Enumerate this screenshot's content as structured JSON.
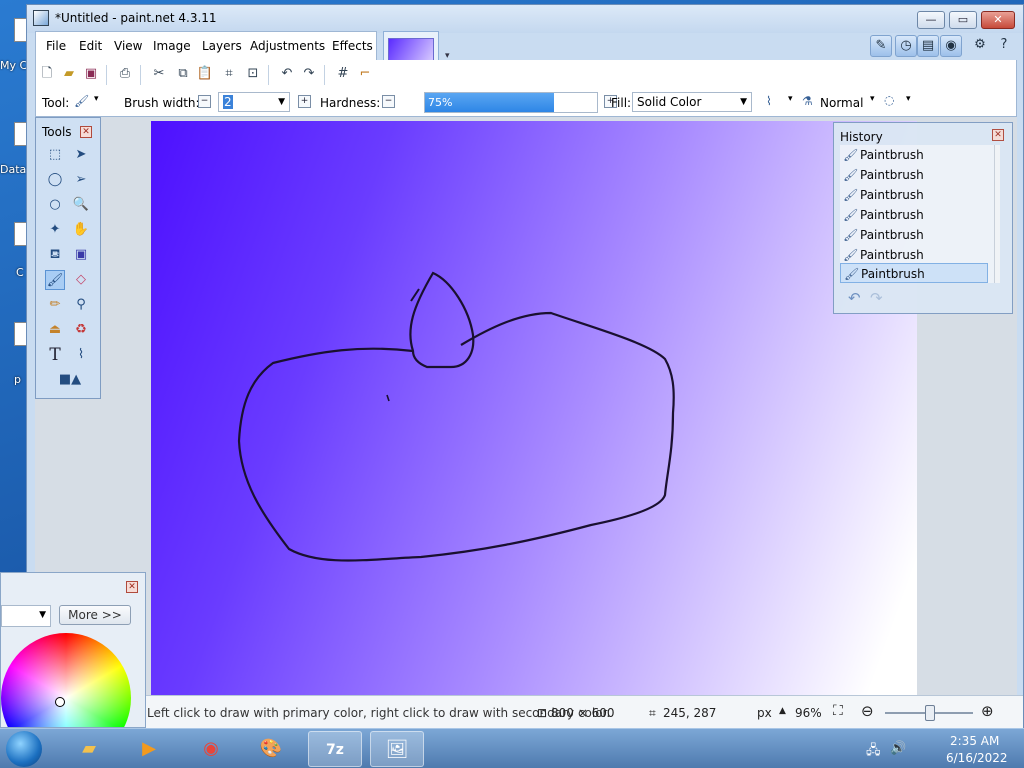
{
  "desktop": {
    "icons": [
      {
        "label": "My C"
      },
      {
        "label": "Data"
      },
      {
        "label": "C"
      },
      {
        "label": "p"
      }
    ]
  },
  "window": {
    "title": "*Untitled - paint.net 4.3.11",
    "controls": {
      "minimize": "—",
      "maximize": "▭",
      "close": "✕"
    }
  },
  "menu": {
    "items": [
      "File",
      "Edit",
      "View",
      "Image",
      "Layers",
      "Adjustments",
      "Effects"
    ]
  },
  "toolbar": {
    "tool_label": "Tool:",
    "brush_width_label": "Brush width:",
    "brush_width_value": "2",
    "hardness_label": "Hardness:",
    "hardness_value": "75%",
    "hardness_fraction": 0.75,
    "fill_label": "Fill:",
    "fill_value": "Solid Color",
    "blend_mode_value": "Normal"
  },
  "tools_panel": {
    "title": "Tools",
    "icons": [
      "rectangle-select-icon",
      "move-selection-icon",
      "lasso-select-icon",
      "move-selected-icon",
      "ellipse-select-icon",
      "zoom-icon",
      "magic-wand-icon",
      "pan-icon",
      "paint-bucket-icon",
      "gradient-icon",
      "paintbrush-icon",
      "eraser-icon",
      "pencil-icon",
      "color-picker-icon",
      "clone-stamp-icon",
      "recolor-icon",
      "text-icon",
      "line-curve-icon",
      "shapes-icon"
    ]
  },
  "history_panel": {
    "title": "History",
    "items": [
      "Paintbrush",
      "Paintbrush",
      "Paintbrush",
      "Paintbrush",
      "Paintbrush",
      "Paintbrush",
      "Paintbrush"
    ]
  },
  "colors_panel": {
    "more_label": "More >>"
  },
  "status": {
    "hint": "Left click to draw with primary color, right click to draw with secondary color.",
    "image_size": "800 × 600",
    "cursor_pos": "245, 287",
    "units": "px",
    "zoom": "96%"
  },
  "taskbar": {
    "time": "2:35 AM",
    "date": "6/16/2022",
    "items": [
      "explorer",
      "media-player",
      "chrome",
      "paint.net",
      "7z",
      "paint.net-active"
    ]
  },
  "colors": {
    "canvas_start": "#4d10ff",
    "canvas_end": "#ffffff",
    "stroke": "#1a1030",
    "accent": "#2e86e6"
  }
}
